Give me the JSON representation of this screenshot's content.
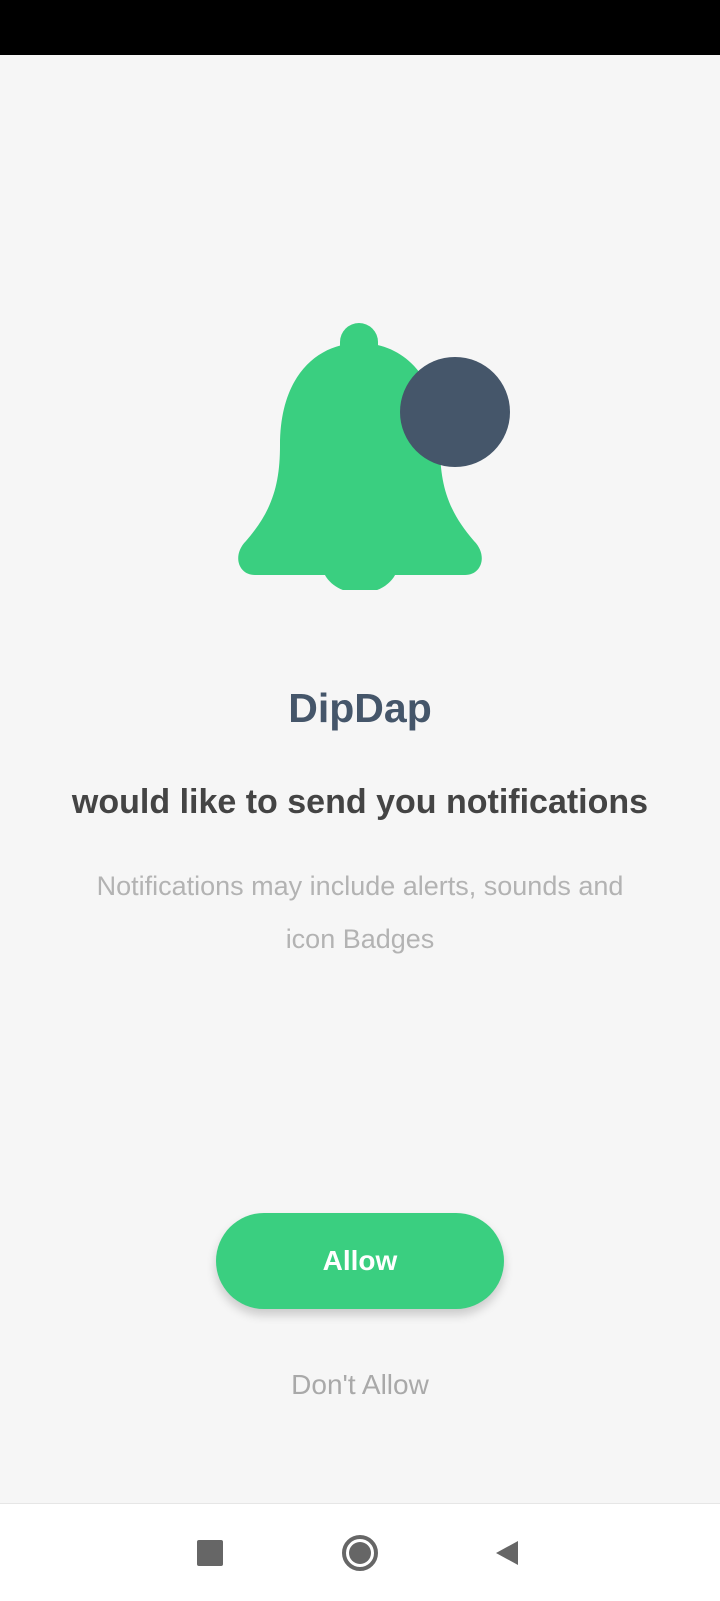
{
  "app": {
    "name": "DipDap"
  },
  "prompt": {
    "headline": "would like to send you notifications",
    "description": "Notifications may include alerts, sounds and icon Badges"
  },
  "actions": {
    "allow_label": "Allow",
    "deny_label": "Don't Allow"
  },
  "colors": {
    "accent": "#3acf80",
    "badge": "#45566a",
    "background": "#f6f6f6"
  },
  "icons": {
    "illustration": "bell-icon",
    "badge": "notification-dot-icon",
    "nav": [
      "recent-apps-icon",
      "home-icon",
      "back-icon"
    ]
  }
}
